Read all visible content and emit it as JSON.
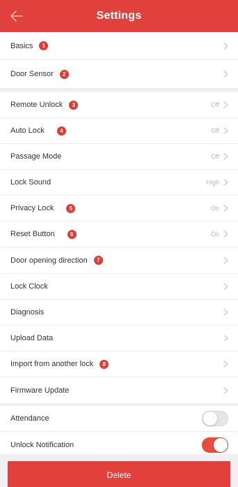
{
  "header": {
    "title": "Settings",
    "back_icon": "arrow-left-icon"
  },
  "colors": {
    "brand": "#e0413d",
    "badge": "#e23a35",
    "toggle_on": "#e94b3c"
  },
  "groups": [
    {
      "items": [
        {
          "label": "Basics",
          "badge": "1"
        },
        {
          "label": "Door Sensor",
          "badge": "2"
        }
      ]
    },
    {
      "items": [
        {
          "label": "Remote Unlock",
          "badge": "3",
          "value": "Off"
        },
        {
          "label": "Auto Lock",
          "badge": "4",
          "value": "Off"
        },
        {
          "label": "Passage Mode",
          "value": "Off"
        },
        {
          "label": "Lock Sound",
          "value": "High"
        },
        {
          "label": "Privacy Lock",
          "badge": "5",
          "value": "On"
        },
        {
          "label": "Reset Button",
          "badge": "6",
          "value": "On"
        },
        {
          "label": "Door opening direction",
          "badge": "7"
        }
      ]
    },
    {
      "items": [
        {
          "label": "Lock Clock"
        },
        {
          "label": "Diagnosis"
        },
        {
          "label": "Upload Data"
        },
        {
          "label": "Import from another lock",
          "badge": "8"
        },
        {
          "label": "Firmware Update"
        }
      ]
    },
    {
      "items": [
        {
          "label": "Attendance",
          "toggle": false
        },
        {
          "label": "Unlock Notification",
          "toggle": true
        }
      ]
    }
  ],
  "delete_label": "Delete"
}
